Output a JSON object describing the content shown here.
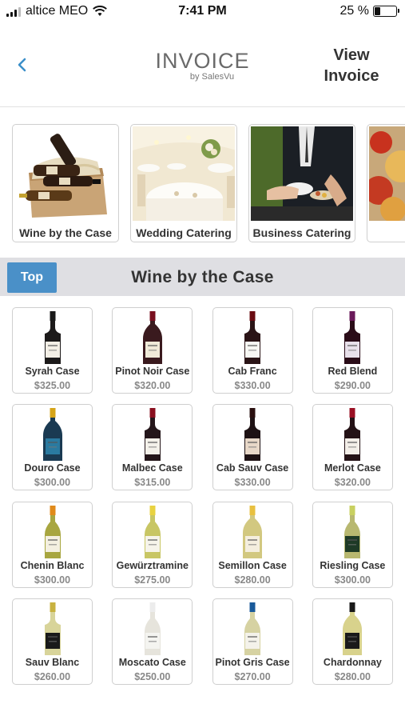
{
  "status": {
    "carrier": "altice MEO",
    "time": "7:41 PM",
    "battery": "25 %",
    "battery_level": 0.25
  },
  "header": {
    "logo_title": "INVOICE",
    "logo_sub": "by SalesVu",
    "view_invoice_line1": "View",
    "view_invoice_line2": "Invoice"
  },
  "categories": [
    {
      "label": "Wine by the Case"
    },
    {
      "label": "Wedding Catering"
    },
    {
      "label": "Business Catering"
    },
    {
      "label": ""
    }
  ],
  "section": {
    "top_label": "Top",
    "title": "Wine by the Case"
  },
  "products": [
    {
      "name": "Syrah Case",
      "price": "$325.00"
    },
    {
      "name": "Pinot Noir Case",
      "price": "$320.00"
    },
    {
      "name": "Cab Franc",
      "price": "$330.00"
    },
    {
      "name": "Red Blend",
      "price": "$290.00"
    },
    {
      "name": "Douro Case",
      "price": "$300.00"
    },
    {
      "name": "Malbec Case",
      "price": "$315.00"
    },
    {
      "name": "Cab Sauv Case",
      "price": "$330.00"
    },
    {
      "name": "Merlot Case",
      "price": "$320.00"
    },
    {
      "name": "Chenin Blanc",
      "price": "$300.00"
    },
    {
      "name": "Gewürztramine",
      "price": "$275.00"
    },
    {
      "name": "Semillon Case",
      "price": "$280.00"
    },
    {
      "name": "Riesling Case",
      "price": "$300.00"
    },
    {
      "name": "Sauv Blanc",
      "price": "$260.00"
    },
    {
      "name": "Moscato Case",
      "price": "$250.00"
    },
    {
      "name": "Pinot Gris Case",
      "price": "$270.00"
    },
    {
      "name": "Chardonnay",
      "price": "$280.00"
    }
  ],
  "colors": {
    "accent": "#4a90c8",
    "section_bg": "#dfdfe3"
  }
}
